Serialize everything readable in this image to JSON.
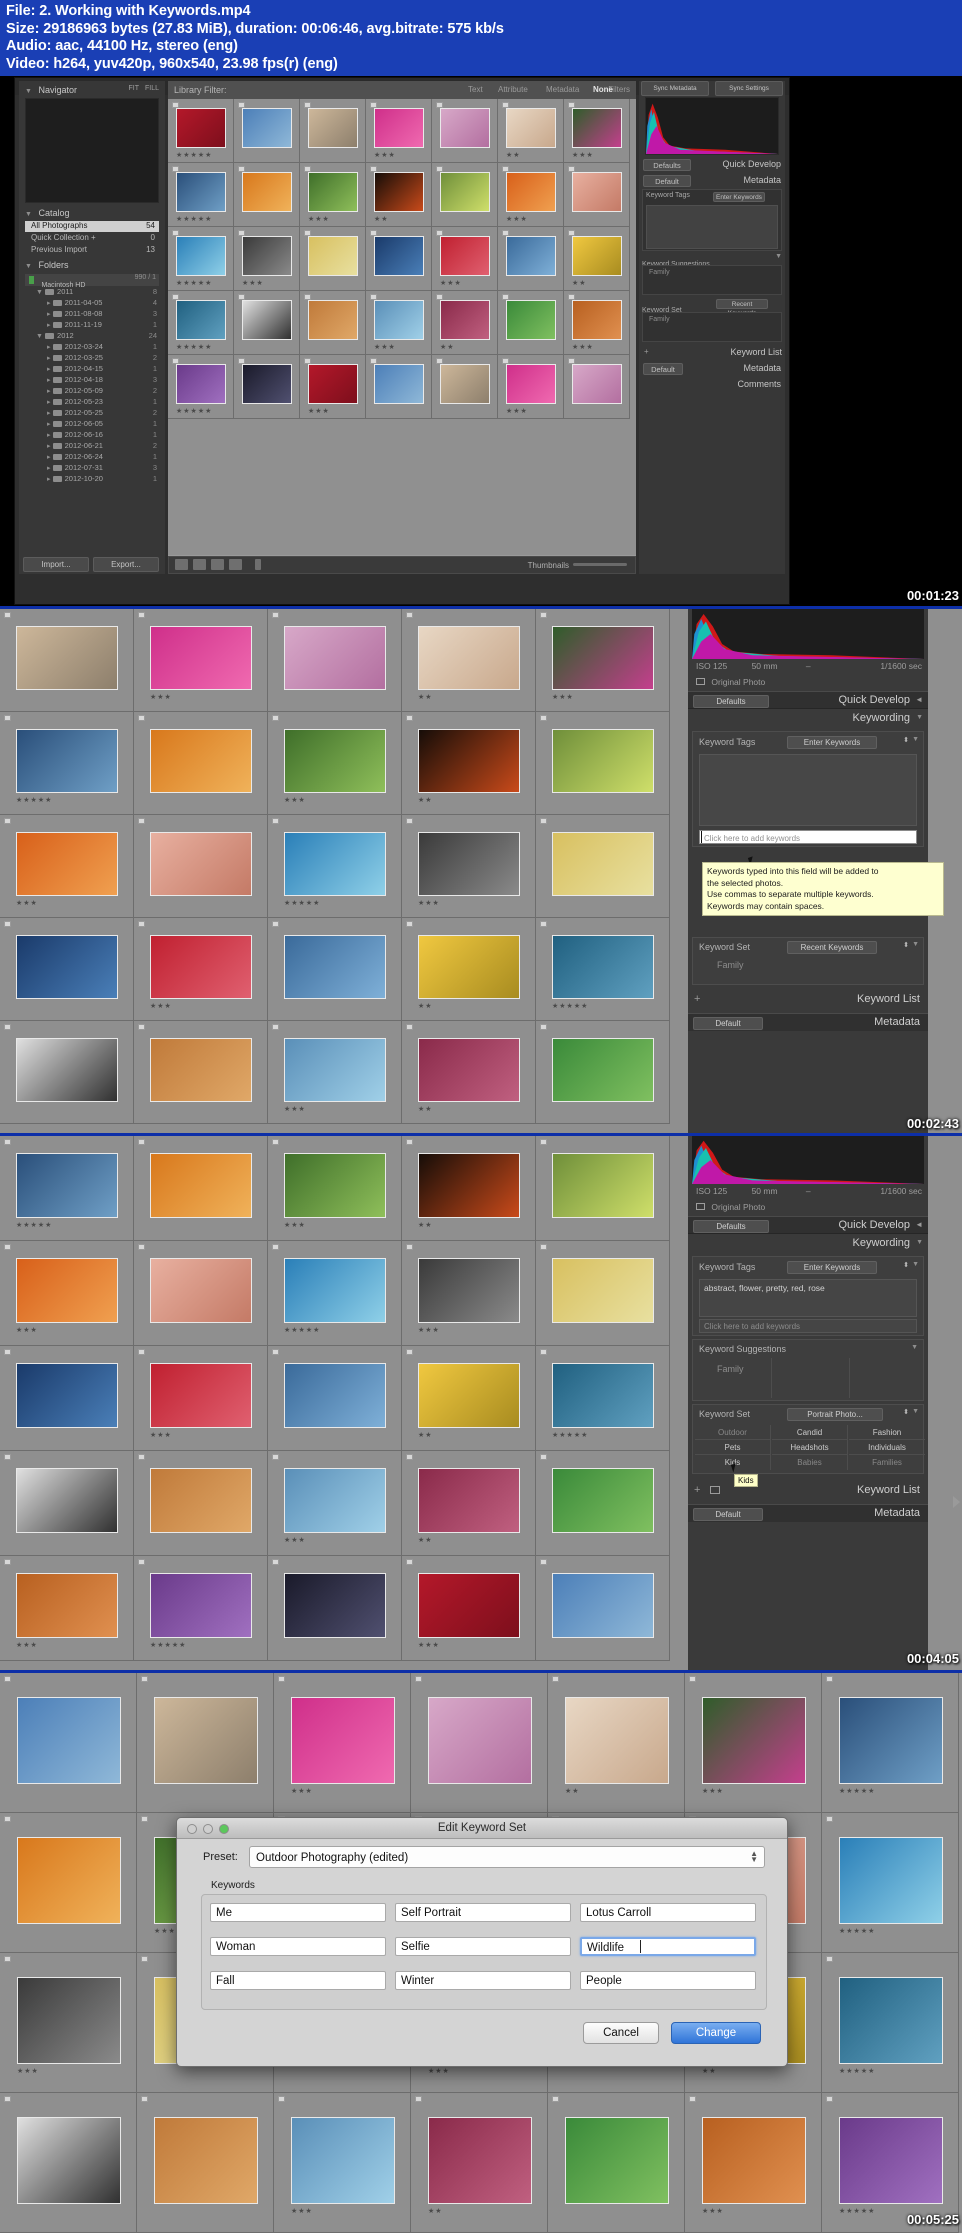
{
  "header": {
    "line1": "File: 2. Working with Keywords.mp4",
    "line2": "Size: 29186963 bytes (27.83 MiB), duration: 00:06:46, avg.bitrate: 575 kb/s",
    "line3": "Audio: aac, 44100 Hz, stereo (eng)",
    "line4": "Video: h264, yuv420p, 960x540, 23.98 fps(r) (eng)"
  },
  "timestamps": [
    "00:01:23",
    "00:02:43",
    "00:04:05",
    "00:05:25"
  ],
  "lightroom": {
    "library_filter": {
      "label": "Library Filter:",
      "options": [
        "Text",
        "Attribute",
        "Metadata",
        "None"
      ],
      "selected": "None",
      "right_label": "Filters"
    },
    "left_panel": {
      "navigator": {
        "title": "Navigator",
        "fit": "FIT",
        "fill": "FILL"
      },
      "catalog": {
        "title": "Catalog",
        "items": [
          {
            "label": "All Photographs",
            "count": "54",
            "selected": true
          },
          {
            "label": "Quick Collection  +",
            "count": "0",
            "selected": false
          },
          {
            "label": "Previous Import",
            "count": "13",
            "selected": false
          }
        ]
      },
      "folders": {
        "title": "Folders",
        "volume": {
          "label": "Macintosh HD",
          "free": "990 / 1"
        },
        "tree": [
          {
            "label": "2011",
            "level": 1,
            "count": "8"
          },
          {
            "label": "2011-04-05",
            "level": 2,
            "count": "4"
          },
          {
            "label": "2011-08-08",
            "level": 2,
            "count": "3"
          },
          {
            "label": "2011-11-19",
            "level": 2,
            "count": "1"
          },
          {
            "label": "2012",
            "level": 1,
            "count": "24"
          },
          {
            "label": "2012-03-24",
            "level": 2,
            "count": "1"
          },
          {
            "label": "2012-03-25",
            "level": 2,
            "count": "2"
          },
          {
            "label": "2012-04-15",
            "level": 2,
            "count": "1"
          },
          {
            "label": "2012-04-18",
            "level": 2,
            "count": "3"
          },
          {
            "label": "2012-05-09",
            "level": 2,
            "count": "2"
          },
          {
            "label": "2012-05-23",
            "level": 2,
            "count": "1"
          },
          {
            "label": "2012-05-25",
            "level": 2,
            "count": "2"
          },
          {
            "label": "2012-06-05",
            "level": 2,
            "count": "1"
          },
          {
            "label": "2012-06-16",
            "level": 2,
            "count": "1"
          },
          {
            "label": "2012-06-21",
            "level": 2,
            "count": "2"
          },
          {
            "label": "2012-06-24",
            "level": 2,
            "count": "1"
          },
          {
            "label": "2012-07-31",
            "level": 2,
            "count": "3"
          },
          {
            "label": "2012-10-20",
            "level": 2,
            "count": "1"
          }
        ]
      },
      "buttons": {
        "import": "Import...",
        "export": "Export..."
      }
    },
    "right_panel": {
      "histogram": "Histogram",
      "exif": {
        "iso": "ISO 125",
        "focal": "50 mm",
        "aperture": "–",
        "shutter": "1/1600 sec"
      },
      "original_photo": "Original Photo",
      "quick_develop": {
        "title": "Quick Develop",
        "preset": "Defaults"
      },
      "keywording": {
        "title": "Keywording",
        "keyword_tags_label": "Keyword Tags",
        "keyword_tags_mode": "Enter Keywords",
        "tags_value_empty": "",
        "tags_value_filled": "abstract, flower, pretty, red, rose",
        "add_placeholder": "Click here to add keywords",
        "suggestions_title": "Keyword Suggestions",
        "suggestion_cells": [
          "Family",
          "",
          "",
          "",
          "",
          "",
          "",
          "",
          ""
        ],
        "keyword_set_label": "Keyword Set",
        "keyword_set_recent": "Recent Keywords",
        "keyword_set_portrait": "Portrait Photo...",
        "set_cells_recent": [
          "Family",
          "",
          "",
          "",
          "",
          "",
          "",
          "",
          ""
        ],
        "set_cells_portrait": [
          "Outdoor",
          "Candid",
          "Fashion",
          "Pets",
          "Headshots",
          "Individuals",
          "Kids",
          "Babies",
          "Families"
        ]
      },
      "keyword_list": "Keyword List",
      "metadata": {
        "title": "Metadata",
        "preset": "Default"
      },
      "comments": "Comments",
      "sync_buttons": [
        "Sync Metadata",
        "Sync Settings"
      ]
    },
    "tooltip": "Keywords typed into this field will be added to\nthe selected photos.\nUse commas to separate multiple keywords.\nKeywords may contain spaces.",
    "hover_tip": "Kids"
  },
  "dialog": {
    "title": "Edit Keyword Set",
    "preset_label": "Preset:",
    "preset_value": "Outdoor Photography (edited)",
    "keywords_label": "Keywords",
    "keywords": [
      {
        "value": "Me",
        "focused": false
      },
      {
        "value": "Self Portrait",
        "focused": false
      },
      {
        "value": "Lotus Carroll",
        "focused": false
      },
      {
        "value": "Woman",
        "focused": false
      },
      {
        "value": "Selfie",
        "focused": false
      },
      {
        "value": "Wildlife",
        "focused": true
      },
      {
        "value": "Fall",
        "focused": false
      },
      {
        "value": "Winter",
        "focused": false
      },
      {
        "value": "People",
        "focused": false
      }
    ],
    "cancel": "Cancel",
    "change": "Change"
  },
  "colors": {
    "header_blue": "#1a3fb5",
    "accent_blue": "#2f74d8",
    "panel_gray": "#3a3a3a",
    "grid_gray": "#8f8f8f"
  }
}
